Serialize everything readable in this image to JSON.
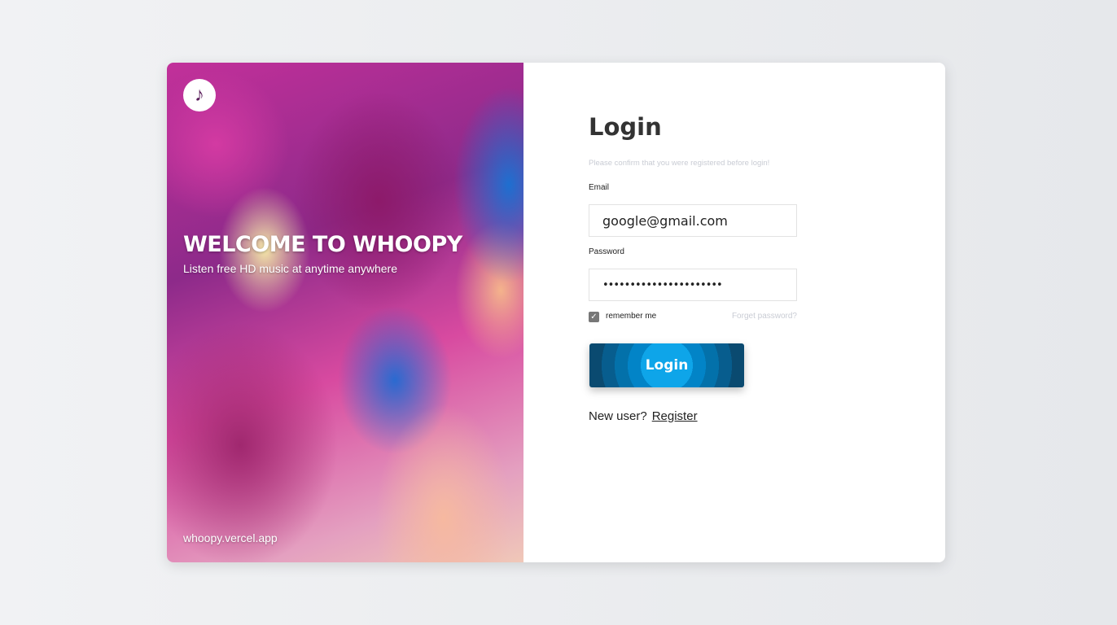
{
  "hero": {
    "logo_icon": "music-note-icon",
    "title": "WELCOME TO WHOOPY",
    "subtitle": "Listen free HD music at anytime anywhere",
    "site": "whoopy.vercel.app"
  },
  "form": {
    "title": "Login",
    "hint": "Please confirm that you were registered before login!",
    "email_label": "Email",
    "email_value": "google@gmail.com",
    "password_label": "Password",
    "password_masked": "••••••••••••••••••••••",
    "remember_label": "remember me",
    "remember_checked": true,
    "forgot_label": "Forget password?",
    "login_label": "Login",
    "new_user_label": "New user?",
    "register_label": "Register"
  },
  "colors": {
    "button_accent": "#0ea5e9",
    "button_dark": "#0a4a70"
  }
}
